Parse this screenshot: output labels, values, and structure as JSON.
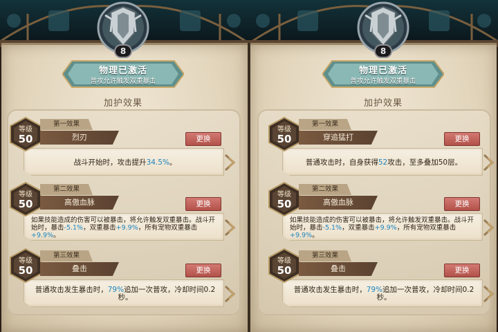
{
  "panels": [
    {
      "level": "8",
      "status_title": "物理已激活",
      "status_sub": "普攻允许触发双重暴击",
      "section_title": "加护效果",
      "effects": [
        {
          "level_label": "等级",
          "level_value": "50",
          "order": "第一效果",
          "name": "烈刃",
          "swap": "更换",
          "desc_parts": [
            "战斗开始时，攻击提升",
            "34.5%",
            "。"
          ]
        },
        {
          "level_label": "等级",
          "level_value": "50",
          "order": "第二效果",
          "name": "高傲血脉",
          "swap": "更换",
          "desc_parts": [
            "如果技能造成的伤害可以被暴击，将允许触发双重暴击。战斗开始时，暴击",
            "-5.1%",
            "，双重暴击",
            "+9.9%",
            "，所有宠物双重暴击",
            "+9.9%",
            "。"
          ]
        },
        {
          "level_label": "等级",
          "level_value": "50",
          "order": "第三效果",
          "name": "叠击",
          "swap": "更换",
          "desc_parts": [
            "普通攻击发生暴击时，",
            "79%",
            "追加一次普攻，冷却时间0.2秒。"
          ]
        }
      ]
    },
    {
      "level": "8",
      "status_title": "物理已激活",
      "status_sub": "普攻允许触发双重暴击",
      "section_title": "加护效果",
      "effects": [
        {
          "level_label": "等级",
          "level_value": "50",
          "order": "第一效果",
          "name": "穿追猛打",
          "swap": "更换",
          "desc_parts": [
            "普通攻击时，自身获得",
            "52",
            "攻击，至多叠加50层。"
          ]
        },
        {
          "level_label": "等级",
          "level_value": "50",
          "order": "第二效果",
          "name": "高傲血脉",
          "swap": "更换",
          "desc_parts": [
            "如果技能造成的伤害可以被暴击，将允许触发双重暴击。战斗开始时，暴击",
            "-5.1%",
            "，双重暴击",
            "+9.9%",
            "，所有宠物双重暴击",
            "+9.9%",
            "。"
          ]
        },
        {
          "level_label": "等级",
          "level_value": "50",
          "order": "第三效果",
          "name": "叠击",
          "swap": "更换",
          "desc_parts": [
            "普通攻击发生暴击时，",
            "79%",
            "追加一次普攻，冷却时间0.2秒。"
          ]
        }
      ]
    }
  ],
  "colors": {
    "highlight": "#1f86c0",
    "swap_button": "#c0625a",
    "plate": "#8fc0bc"
  },
  "icons": {
    "emblem": "crest-shield-icon",
    "arrow": "chevron-right-icon"
  }
}
